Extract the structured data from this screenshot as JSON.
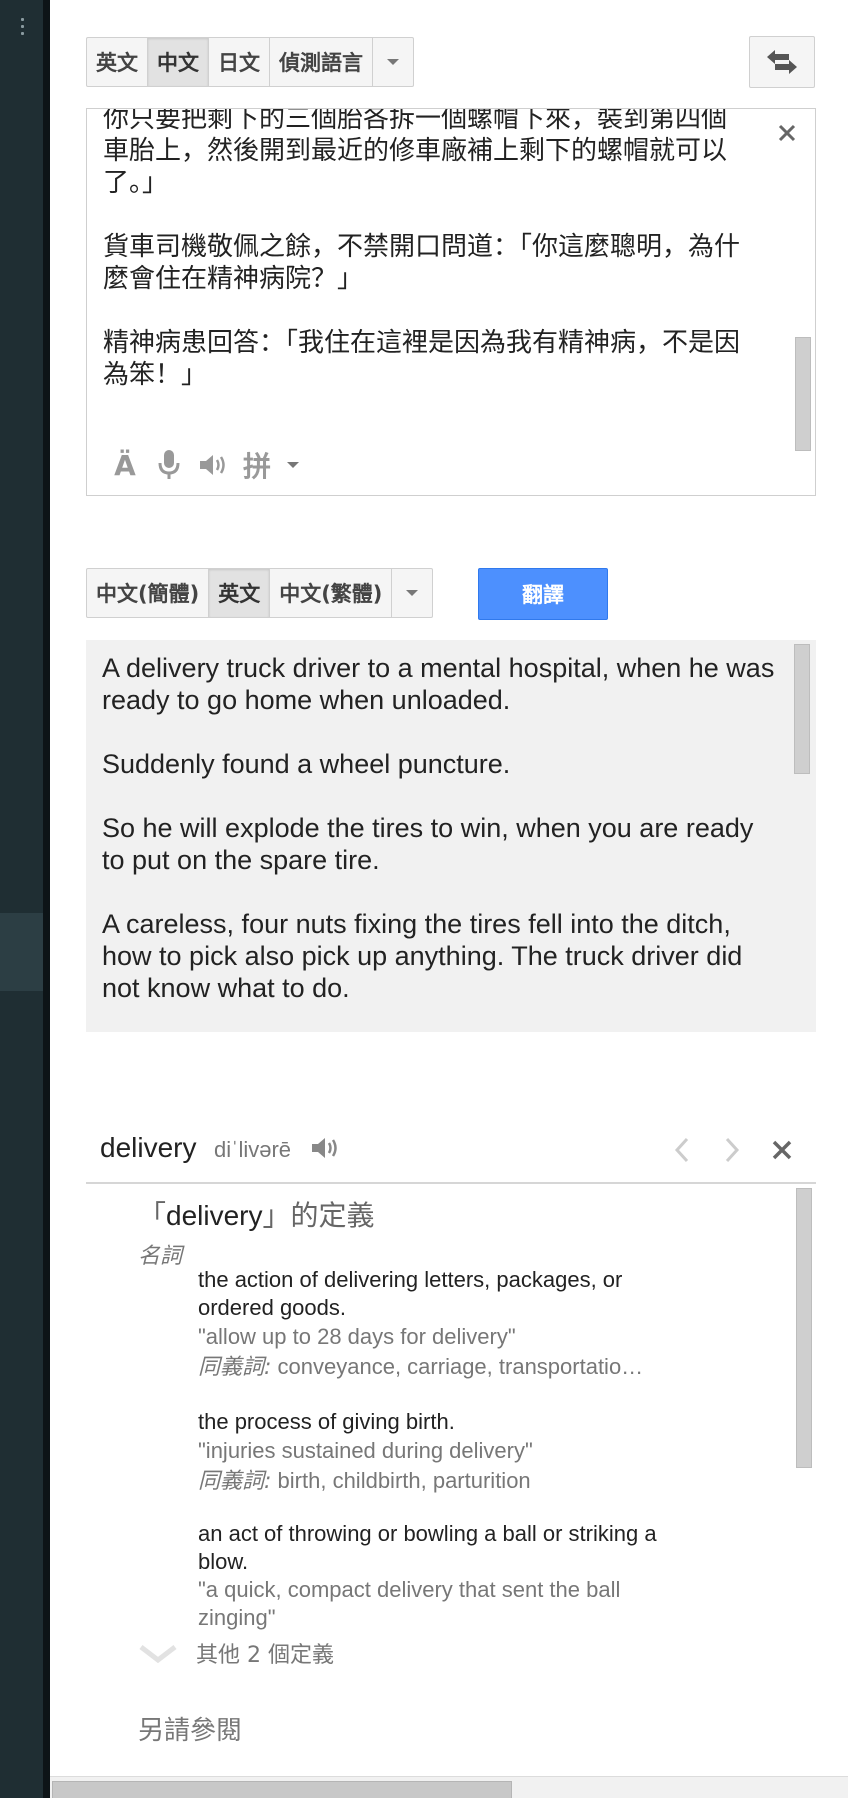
{
  "source_lang_bar": {
    "options": [
      "英文",
      "中文",
      "日文",
      "偵測語言"
    ],
    "selected": "中文"
  },
  "source": {
    "paragraphs": [
      "你只要把剩下的三個胎各拆一個螺帽下來，裝到第四個車胎上，然後開到最近的修車廠補上剩下的螺帽就可以了。」",
      "貨車司機敬佩之餘，不禁開口問道：「你這麼聰明，為什麼會住在精神病院？」",
      "精神病患回答：「我住在這裡是因為我有精神病，不是因為笨！」"
    ],
    "input_tool_label": "拼"
  },
  "target_lang_bar": {
    "options": [
      "中文(簡體)",
      "英文",
      "中文(繁體)"
    ],
    "selected": "英文"
  },
  "translate_button": "翻譯",
  "result": {
    "paragraphs": [
      "A delivery truck driver to a mental hospital, when he was ready to go home when unloaded.",
      "Suddenly found a wheel puncture.",
      "So he will explode the tires to win, when you are ready to put on the spare tire.",
      "A careless, four nuts fixing the tires fell into the ditch, how to pick also pick up anything. The truck driver did not know what to do."
    ]
  },
  "dictionary": {
    "word": "delivery",
    "phonetic": "diˈlivərē",
    "definition_heading_open": "「",
    "definition_heading_word": "delivery",
    "definition_heading_close": "」的定義",
    "part_of_speech": "名詞",
    "synonyms_label": "同義詞:",
    "senses": [
      {
        "definition": "the action of delivering letters, packages, or ordered goods.",
        "example": "\"allow up to 28 days for delivery\"",
        "synonyms": "conveyance, carriage, transportatio…"
      },
      {
        "definition": "the process of giving birth.",
        "example": "\"injuries sustained during delivery\"",
        "synonyms": "birth, childbirth, parturition"
      },
      {
        "definition": "an act of throwing or bowling a ball or striking a blow.",
        "example": "\"a quick, compact delivery that sent the ball zinging\"",
        "synonyms": ""
      }
    ],
    "more_definitions": "其他 2 個定義",
    "see_also": "另請參閱"
  },
  "colors": {
    "rail": "#1f2e33",
    "translate_button": "#4d90fe",
    "result_bg": "#f1f1f1"
  }
}
